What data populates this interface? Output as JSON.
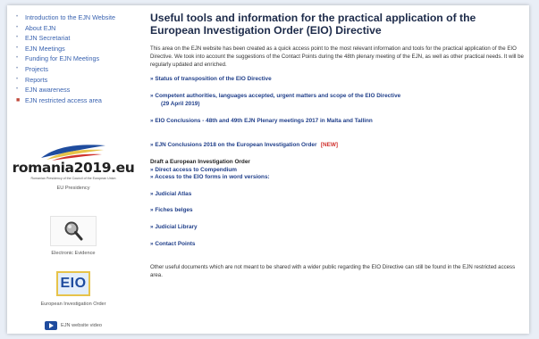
{
  "sidebar": {
    "nav": [
      {
        "label": "Introduction to the EJN Website"
      },
      {
        "label": "About EJN"
      },
      {
        "label": "EJN Secretariat"
      },
      {
        "label": "EJN Meetings"
      },
      {
        "label": "Funding for EJN Meetings"
      },
      {
        "label": "Projects"
      },
      {
        "label": "Reports"
      },
      {
        "label": "EJN awareness"
      },
      {
        "label": "EJN restricted access area"
      }
    ],
    "romania": {
      "logo_text": "romania2019.eu",
      "tagline": "Romanian Presidency of the Council of the European Union",
      "caption": "EU Presidency"
    },
    "electronic_evidence": {
      "caption": "Electronic Evidence"
    },
    "eio": {
      "logo_text": "EIO",
      "caption": "European Investigation Order"
    },
    "video": {
      "label": "EJN website video"
    }
  },
  "main": {
    "title": "Useful tools and information for the practical application of the European Investigation Order (EIO) Directive",
    "intro": "This area on the EJN website has been created as a quick access point to the most relevant information and tools for the practical application of the EIO Directive. We took into account the suggestions of the Contact Points during the 48th plenary meeting of the EJN, as well as other practical needs. It will be regularly updated and enriched.",
    "links": {
      "status": "» Status of transposition of the EIO Directive",
      "competent": "» Competent authorities, languages accepted, urgent matters and scope of the EIO Directive",
      "competent_date": "(29 April 2019)",
      "conclusions_2017": "» EIO Conclusions - 48th and 49th EJN Plenary meetings 2017 in Malta and Tallinn",
      "conclusions_2018": "» EJN Conclusions 2018 on the European Investigation Order",
      "new_badge": "[NEW]",
      "draft_heading": "Draft a European Investigation Order",
      "compendium": "» Direct access to Compendium",
      "word_forms": "» Access to the EIO forms in word versions:",
      "atlas": "» Judicial Atlas",
      "fiches": "» Fiches belges",
      "library": "» Judicial Library",
      "contact": "» Contact Points"
    },
    "footer": "Other useful documents which are not meant to be shared with a wider public regarding the EIO Directive can still be found in the EJN restricted access area."
  },
  "colors": {
    "link": "#203f8a",
    "nav": "#3a63b0",
    "badge": "#d0312d",
    "eio_border": "#e7c34a",
    "eio_text": "#1f4c9e"
  }
}
